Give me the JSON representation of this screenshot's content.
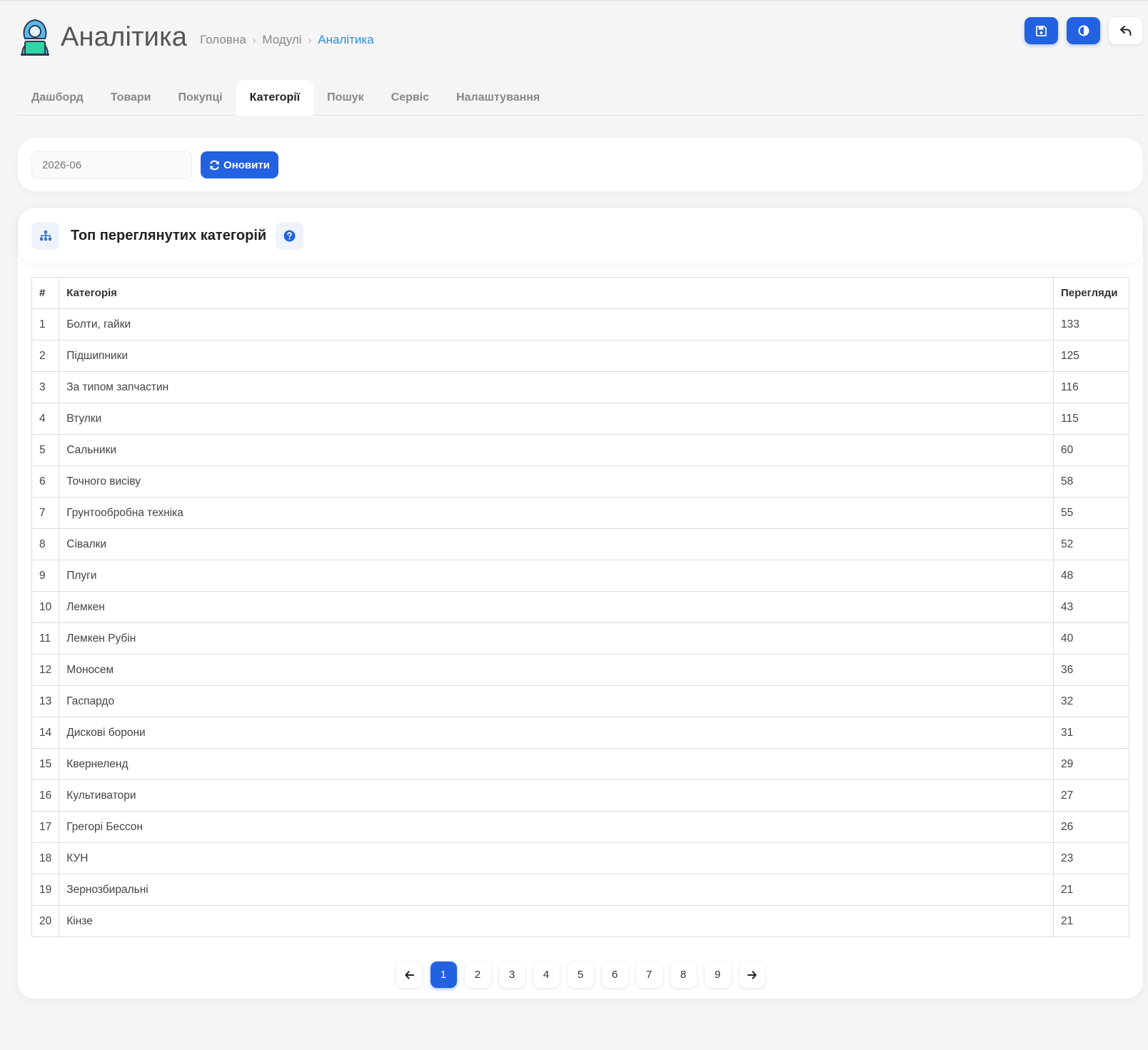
{
  "app": {
    "title": "Аналітика"
  },
  "breadcrumb": [
    {
      "label": "Головна"
    },
    {
      "label": "Модулі"
    },
    {
      "label": "Аналітика"
    }
  ],
  "header_actions": [
    {
      "icon": "save-icon"
    },
    {
      "icon": "contrast-icon"
    },
    {
      "icon": "undo-icon"
    }
  ],
  "tabs": [
    {
      "label": "Дашборд"
    },
    {
      "label": "Товари"
    },
    {
      "label": "Покупці"
    },
    {
      "label": "Категорії",
      "active": true
    },
    {
      "label": "Пошук"
    },
    {
      "label": "Сервіс"
    },
    {
      "label": "Налаштування"
    }
  ],
  "filter": {
    "month_value": "2026-06",
    "refresh_label": "Оновити"
  },
  "card": {
    "title": "Топ переглянутих категорій"
  },
  "table": {
    "columns": [
      "#",
      "Категорія",
      "Перегляди"
    ],
    "rows": [
      [
        "1",
        "Болти, гайки",
        "133"
      ],
      [
        "2",
        "Підшипники",
        "125"
      ],
      [
        "3",
        "За типом запчастин",
        "116"
      ],
      [
        "4",
        "Втулки",
        "115"
      ],
      [
        "5",
        "Сальники",
        "60"
      ],
      [
        "6",
        "Точного висіву",
        "58"
      ],
      [
        "7",
        "Грунтообробна техніка",
        "55"
      ],
      [
        "8",
        "Сівалки",
        "52"
      ],
      [
        "9",
        "Плуги",
        "48"
      ],
      [
        "10",
        "Лемкен",
        "43"
      ],
      [
        "11",
        "Лемкен Рубін",
        "40"
      ],
      [
        "12",
        "Моносем",
        "36"
      ],
      [
        "13",
        "Гаспардо",
        "32"
      ],
      [
        "14",
        "Дискові борони",
        "31"
      ],
      [
        "15",
        "Квернеленд",
        "29"
      ],
      [
        "16",
        "Культиватори",
        "27"
      ],
      [
        "17",
        "Грегорі Бессон",
        "26"
      ],
      [
        "18",
        "КУН",
        "23"
      ],
      [
        "19",
        "Зернозбиральні",
        "21"
      ],
      [
        "20",
        "Кінзе",
        "21"
      ]
    ]
  },
  "pagination": {
    "pages": [
      "1",
      "2",
      "3",
      "4",
      "5",
      "6",
      "7",
      "8",
      "9"
    ],
    "current": "1"
  },
  "colors": {
    "accent": "#2262e0",
    "breadcrumb_active": "#2b8fd9",
    "logo_teal": "#2fd4a7",
    "logo_blue": "#4a9fe0"
  }
}
